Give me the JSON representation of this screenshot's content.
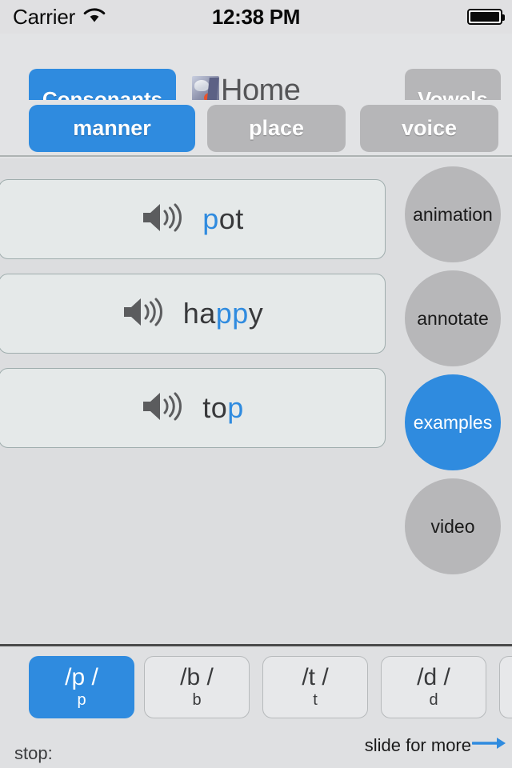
{
  "statusbar": {
    "carrier": "Carrier",
    "time": "12:38 PM",
    "wifi_icon": "wifi-icon",
    "battery_icon": "battery-full-icon"
  },
  "header": {
    "consonants_label": "Consonants",
    "home_label": "Home",
    "home_thumb_icon": "home-thumbnail-image",
    "vowels_label": "Vowels"
  },
  "feature_tabs": [
    {
      "label": "manner",
      "selected": true
    },
    {
      "label": "place",
      "selected": false
    },
    {
      "label": "voice",
      "selected": false
    }
  ],
  "examples": [
    {
      "word_prefix": "",
      "word_highlight": "p",
      "word_suffix": "ot",
      "speaker_icon": "speaker-icon"
    },
    {
      "word_prefix": "ha",
      "word_highlight": "pp",
      "word_suffix": "y",
      "speaker_icon": "speaker-icon"
    },
    {
      "word_prefix": "to",
      "word_highlight": "p",
      "word_suffix": "",
      "speaker_icon": "speaker-icon"
    }
  ],
  "mode_buttons": [
    {
      "label": "animation",
      "selected": false
    },
    {
      "label": "annotate",
      "selected": false
    },
    {
      "label": "examples",
      "selected": true
    },
    {
      "label": "video",
      "selected": false
    }
  ],
  "phonemes": [
    {
      "symbol": "/p /",
      "letter": "p",
      "selected": true
    },
    {
      "symbol": "/b /",
      "letter": "b",
      "selected": false
    },
    {
      "symbol": "/t /",
      "letter": "t",
      "selected": false
    },
    {
      "symbol": "/d /",
      "letter": "d",
      "selected": false
    },
    {
      "symbol": "",
      "letter": "",
      "selected": false
    }
  ],
  "footer": {
    "category_label": "stop:",
    "slide_hint": "slide for more",
    "arrow_icon": "arrow-right-icon"
  },
  "colors": {
    "accent_blue": "#2f8bdf",
    "inactive_gray": "#b6b6b8",
    "page_background": "#e2e3e5",
    "content_background": "#dcdddf",
    "text_dark": "#38393b"
  }
}
